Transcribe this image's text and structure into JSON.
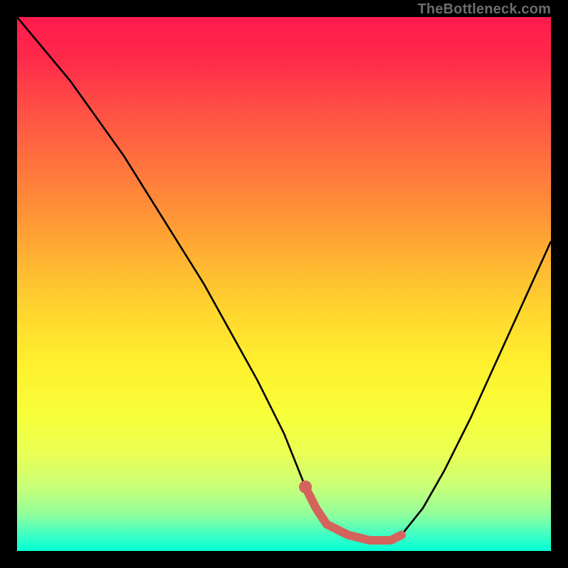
{
  "watermark": "TheBottleneck.com",
  "chart_data": {
    "type": "line",
    "title": "",
    "xlabel": "",
    "ylabel": "",
    "xlim": [
      0,
      100
    ],
    "ylim": [
      0,
      100
    ],
    "grid": false,
    "legend": false,
    "series": [
      {
        "name": "bottleneck-curve",
        "color": "#000000",
        "x": [
          0,
          5,
          10,
          15,
          20,
          25,
          30,
          35,
          40,
          45,
          50,
          54,
          56,
          58,
          62,
          66,
          70,
          72,
          76,
          80,
          85,
          90,
          95,
          100
        ],
        "values": [
          100,
          94,
          88,
          81,
          74,
          66,
          58,
          50,
          41,
          32,
          22,
          12,
          8,
          5,
          3,
          2,
          2,
          3,
          8,
          15,
          25,
          36,
          47,
          58
        ]
      }
    ],
    "highlight_segment": {
      "name": "optimal-range",
      "color": "#d4635c",
      "x": [
        54,
        56,
        58,
        62,
        66,
        70,
        72
      ],
      "values": [
        12,
        8,
        5,
        3,
        2,
        2,
        3
      ]
    },
    "background_gradient": {
      "top": "#ff1a4d",
      "bottom": "#00ffd5"
    }
  }
}
